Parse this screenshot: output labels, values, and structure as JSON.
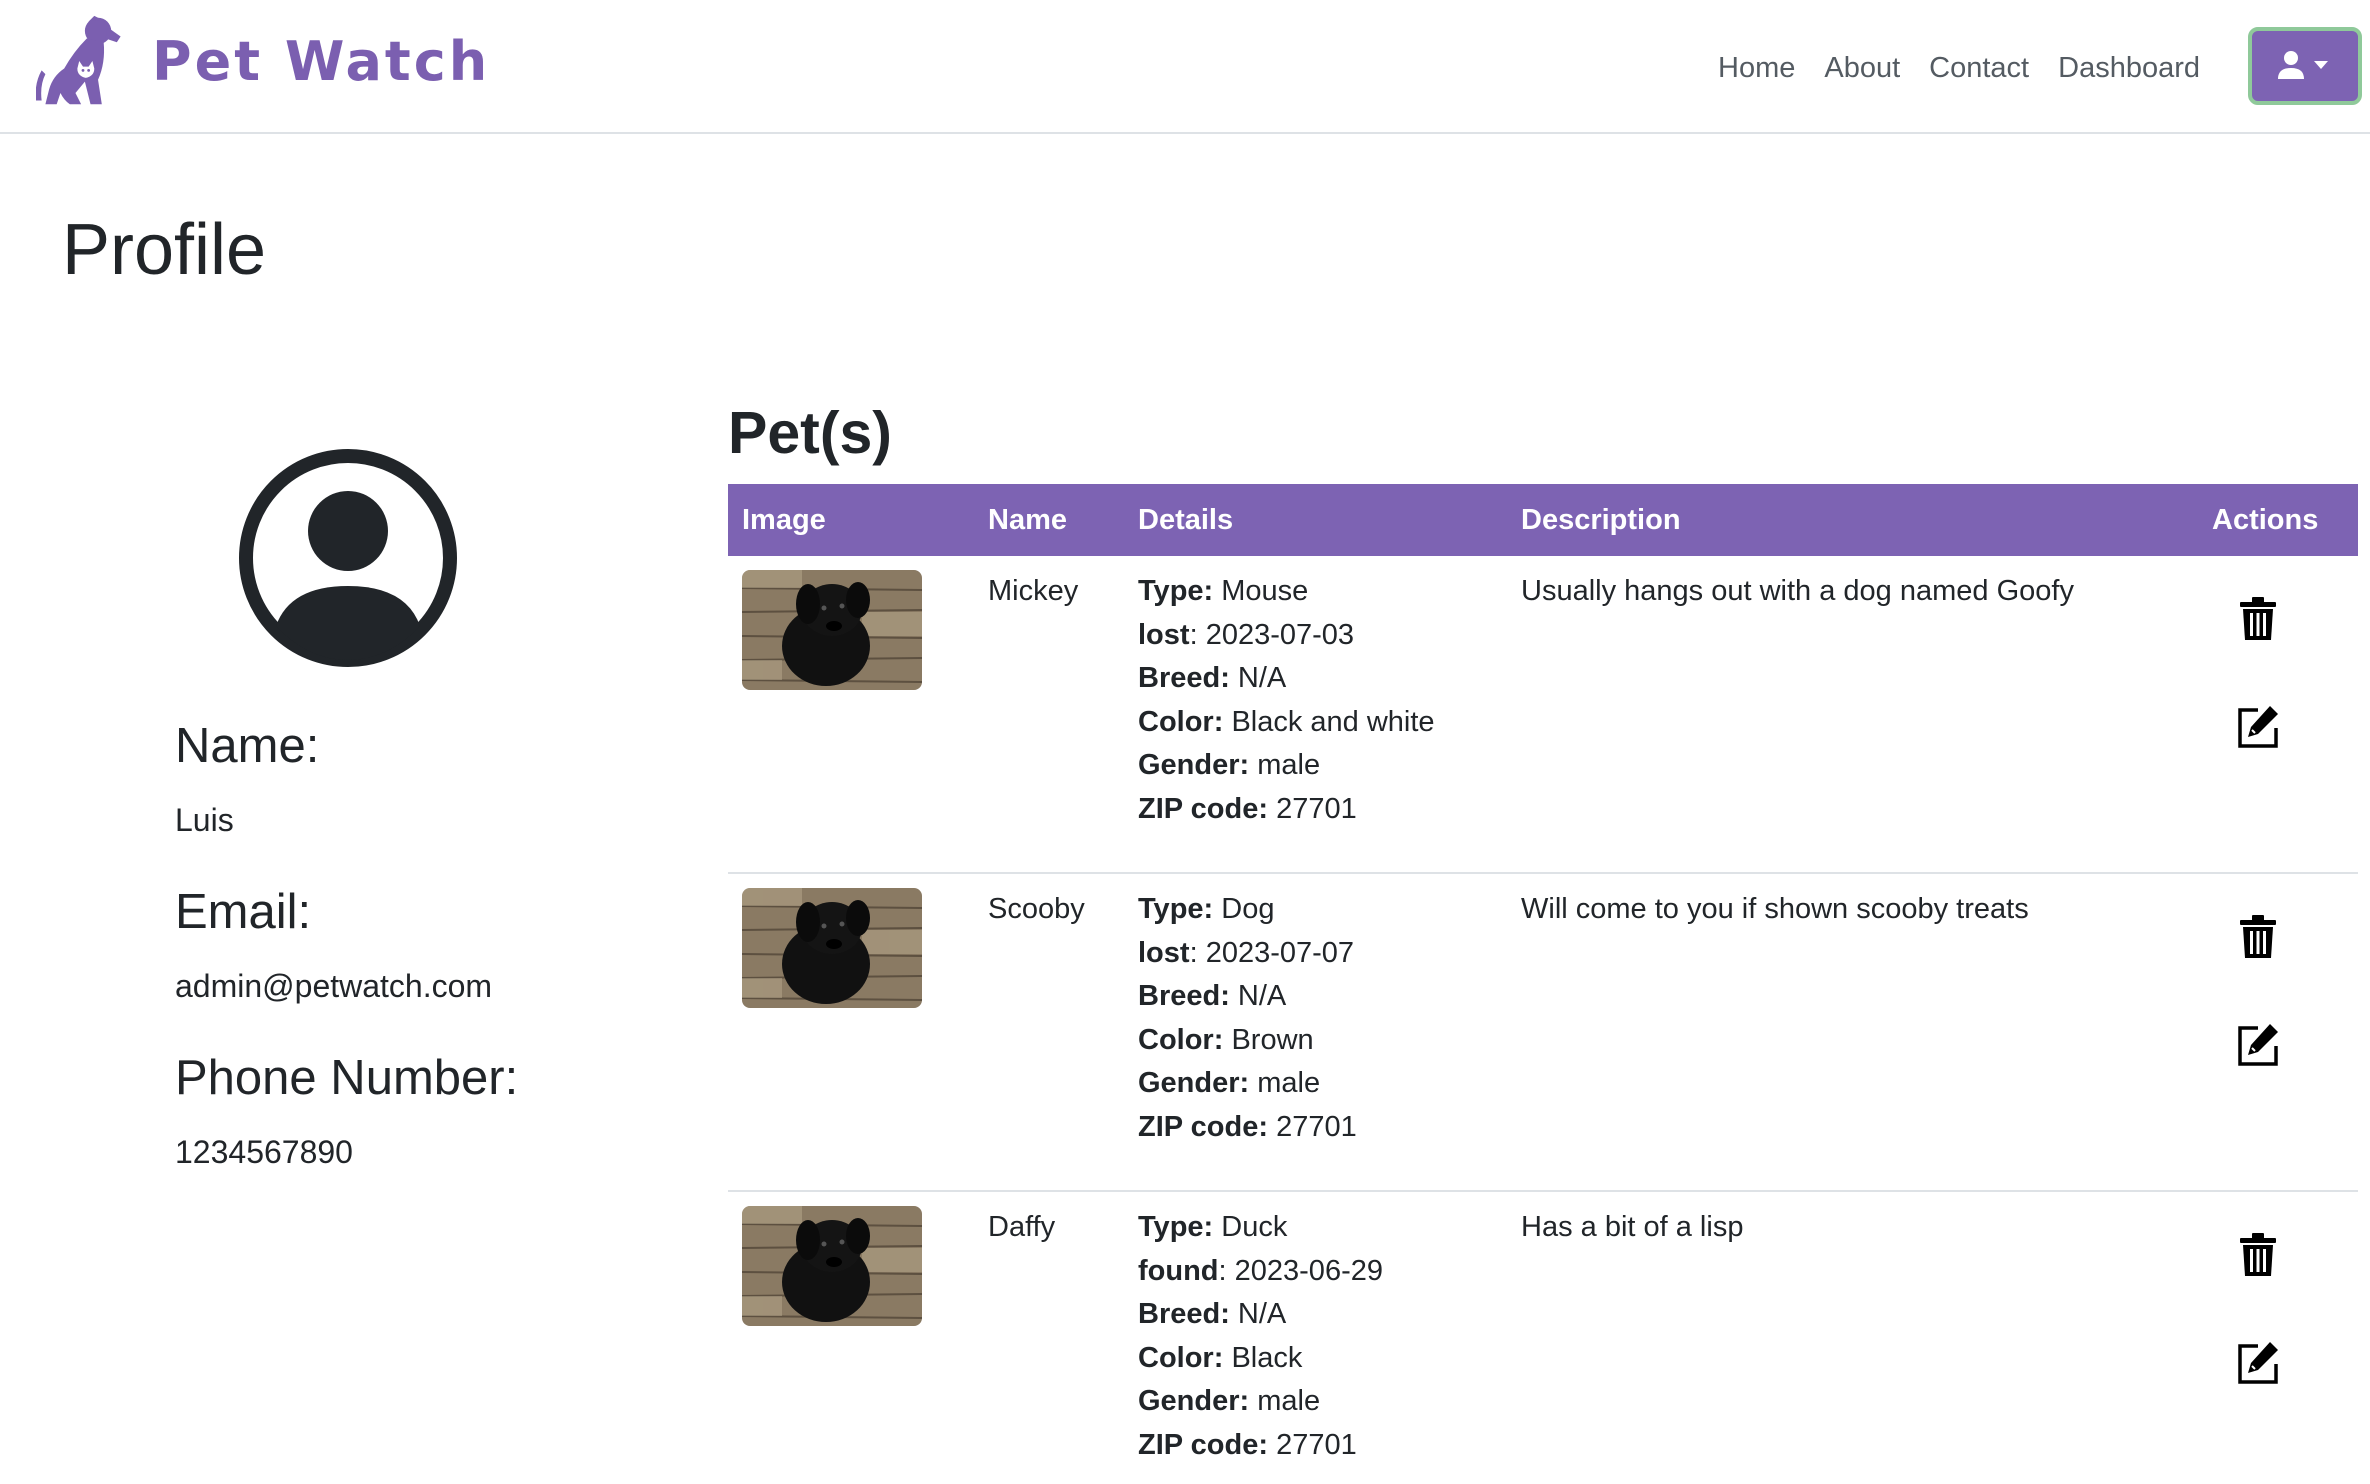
{
  "brand": {
    "name": "Pet Watch",
    "logo_icon": "dog-cat-logo-icon",
    "color": "#7b5fb0"
  },
  "nav": {
    "links": [
      {
        "label": "Home"
      },
      {
        "label": "About"
      },
      {
        "label": "Contact"
      },
      {
        "label": "Dashboard"
      }
    ],
    "user_menu_icon": "user-icon",
    "user_menu_caret": "caret-down-icon"
  },
  "page": {
    "title": "Profile"
  },
  "profile": {
    "avatar_icon": "user-circle-icon",
    "name_label": "Name:",
    "name": "Luis",
    "email_label": "Email:",
    "email": "admin@petwatch.com",
    "phone_label": "Phone Number:",
    "phone": "1234567890"
  },
  "pets": {
    "title": "Pet(s)",
    "columns": [
      "Image",
      "Name",
      "Details",
      "Description",
      "Actions"
    ],
    "detail_labels": {
      "type": "Type:",
      "breed": "Breed:",
      "color": "Color:",
      "gender": "Gender:",
      "zip": "ZIP code:"
    },
    "rows": [
      {
        "name": "Mickey",
        "type": "Mouse",
        "status_label": "lost",
        "date": "2023-07-03",
        "breed": "N/A",
        "color": "Black and white",
        "gender": "male",
        "zip": "27701",
        "description": "Usually hangs out with a dog named Goofy"
      },
      {
        "name": "Scooby",
        "type": "Dog",
        "status_label": "lost",
        "date": "2023-07-07",
        "breed": "N/A",
        "color": "Brown",
        "gender": "male",
        "zip": "27701",
        "description": "Will come to you if shown scooby treats"
      },
      {
        "name": "Daffy",
        "type": "Duck",
        "status_label": "found",
        "date": "2023-06-29",
        "breed": "N/A",
        "color": "Black",
        "gender": "male",
        "zip": "27701",
        "description": "Has a bit of a lisp"
      }
    ],
    "action_icons": [
      "trash-icon",
      "edit-icon"
    ]
  },
  "colors": {
    "accent": "#7d63b3",
    "focus_ring": "#8fc99a",
    "text": "#212529",
    "nav_text": "#545b62"
  }
}
